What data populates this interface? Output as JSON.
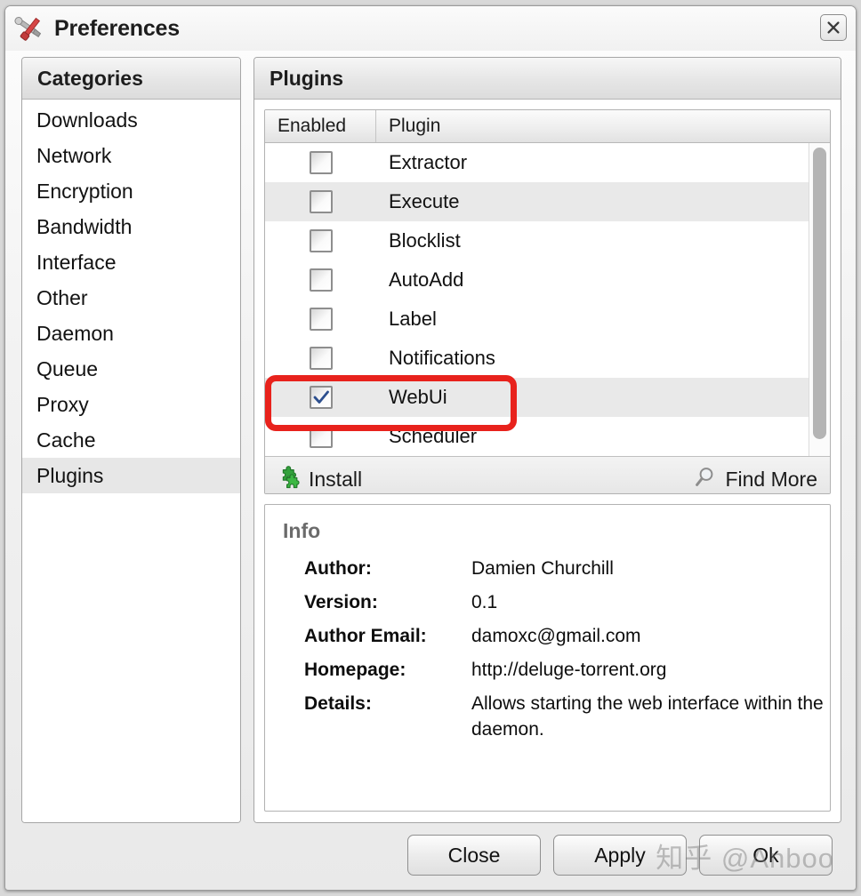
{
  "window": {
    "title": "Preferences",
    "title_icon": "wrench-screwdriver-icon",
    "close_icon": "close-icon"
  },
  "sidebar": {
    "header": "Categories",
    "items": [
      {
        "label": "Downloads",
        "selected": false
      },
      {
        "label": "Network",
        "selected": false
      },
      {
        "label": "Encryption",
        "selected": false
      },
      {
        "label": "Bandwidth",
        "selected": false
      },
      {
        "label": "Interface",
        "selected": false
      },
      {
        "label": "Other",
        "selected": false
      },
      {
        "label": "Daemon",
        "selected": false
      },
      {
        "label": "Queue",
        "selected": false
      },
      {
        "label": "Proxy",
        "selected": false
      },
      {
        "label": "Cache",
        "selected": false
      },
      {
        "label": "Plugins",
        "selected": true
      }
    ]
  },
  "main": {
    "header": "Plugins",
    "table": {
      "columns": [
        "Enabled",
        "Plugin"
      ],
      "rows": [
        {
          "name": "Extractor",
          "enabled": false
        },
        {
          "name": "Execute",
          "enabled": false
        },
        {
          "name": "Blocklist",
          "enabled": false
        },
        {
          "name": "AutoAdd",
          "enabled": false
        },
        {
          "name": "Label",
          "enabled": false
        },
        {
          "name": "Notifications",
          "enabled": false
        },
        {
          "name": "WebUi",
          "enabled": true
        },
        {
          "name": "Scheduler",
          "enabled": false
        }
      ]
    },
    "toolbar": {
      "install_label": "Install",
      "install_icon": "puzzle-piece-icon",
      "find_more_label": "Find More",
      "find_more_icon": "magnifier-icon"
    },
    "info": {
      "title": "Info",
      "author_label": "Author:",
      "author_value": "Damien Churchill",
      "version_label": "Version:",
      "version_value": "0.1",
      "email_label": "Author Email:",
      "email_value": "damoxc@gmail.com",
      "homepage_label": "Homepage:",
      "homepage_value": "http://deluge-torrent.org",
      "details_label": "Details:",
      "details_value": "Allows starting the web interface within the daemon."
    }
  },
  "footer": {
    "close_label": "Close",
    "apply_label": "Apply",
    "ok_label": "Ok"
  },
  "watermark": {
    "text": "知乎 @Anboo"
  },
  "colors": {
    "annotation": "#e8221c",
    "checkmark": "#2d4f8e",
    "install_icon": "#33a13c",
    "selection": "#e7e7e7"
  }
}
